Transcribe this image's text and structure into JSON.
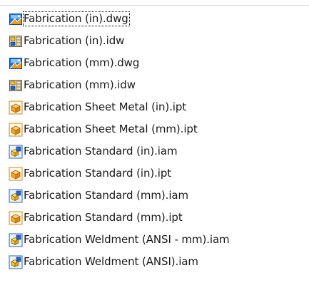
{
  "files": [
    {
      "name": "Fabrication (in).dwg",
      "icon": "dwg-drawing-icon",
      "focused": true
    },
    {
      "name": "Fabrication (in).idw",
      "icon": "idw-drawing-icon",
      "focused": false
    },
    {
      "name": "Fabrication (mm).dwg",
      "icon": "dwg-drawing-icon",
      "focused": false
    },
    {
      "name": "Fabrication (mm).idw",
      "icon": "idw-drawing-icon",
      "focused": false
    },
    {
      "name": "Fabrication Sheet Metal (in).ipt",
      "icon": "ipt-part-icon",
      "focused": false
    },
    {
      "name": "Fabrication Sheet Metal (mm).ipt",
      "icon": "ipt-part-icon",
      "focused": false
    },
    {
      "name": "Fabrication Standard (in).iam",
      "icon": "iam-assembly-icon",
      "focused": false
    },
    {
      "name": "Fabrication Standard (in).ipt",
      "icon": "ipt-part-icon",
      "focused": false
    },
    {
      "name": "Fabrication Standard (mm).iam",
      "icon": "iam-assembly-icon",
      "focused": false
    },
    {
      "name": "Fabrication Standard (mm).ipt",
      "icon": "ipt-part-icon",
      "focused": false
    },
    {
      "name": "Fabrication Weldment (ANSI - mm).iam",
      "icon": "iam-assembly-icon",
      "focused": false
    },
    {
      "name": "Fabrication Weldment (ANSI).iam",
      "icon": "iam-assembly-icon",
      "focused": false
    }
  ],
  "colors": {
    "dwg_blue": "#1e6fd6",
    "dwg_orange": "#f39a1e",
    "part_orange": "#f5a623",
    "assembly_yellow": "#f4c430",
    "assembly_blue": "#2a63c8"
  }
}
